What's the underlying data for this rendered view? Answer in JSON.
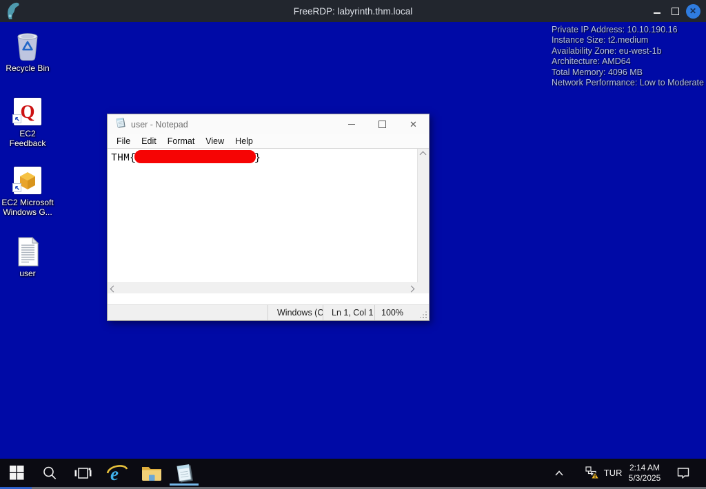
{
  "titlebar": {
    "title": "FreeRDP: labyrinth.thm.local"
  },
  "ec2_info": {
    "lines": [
      "Private IP Address: 10.10.190.16",
      "Instance Size: t2.medium",
      "Availability Zone: eu-west-1b",
      "Architecture: AMD64",
      "Total Memory: 4096 MB",
      "Network Performance: Low to Moderate"
    ]
  },
  "desktop": {
    "icons": [
      {
        "label": "Recycle Bin"
      },
      {
        "label": "EC2 Feedback"
      },
      {
        "label": "EC2 Microsoft Windows G..."
      },
      {
        "label": "user"
      }
    ]
  },
  "notepad": {
    "title": "user - Notepad",
    "menus": [
      "File",
      "Edit",
      "Format",
      "View",
      "Help"
    ],
    "content": {
      "prefix": "THM{",
      "suffix": "}",
      "redacted": "flag hidden by red box"
    },
    "status": {
      "encoding": "Windows (C",
      "cursor": "Ln 1, Col 1",
      "zoom": "100%"
    }
  },
  "taskbar": {
    "tray": {
      "language": "TUR",
      "time": "2:14 AM",
      "date": "5/3/2025"
    }
  },
  "colors": {
    "desktop": "#000aa6",
    "titlebar": "#22262e",
    "taskbar": "#0b0b12",
    "close_button": "#2f7ce0",
    "redaction": "#f60404",
    "taskbar_underline": "#76b8ea",
    "start_underline": "#2f62cc",
    "ec2_text": "#b4c0e8"
  }
}
